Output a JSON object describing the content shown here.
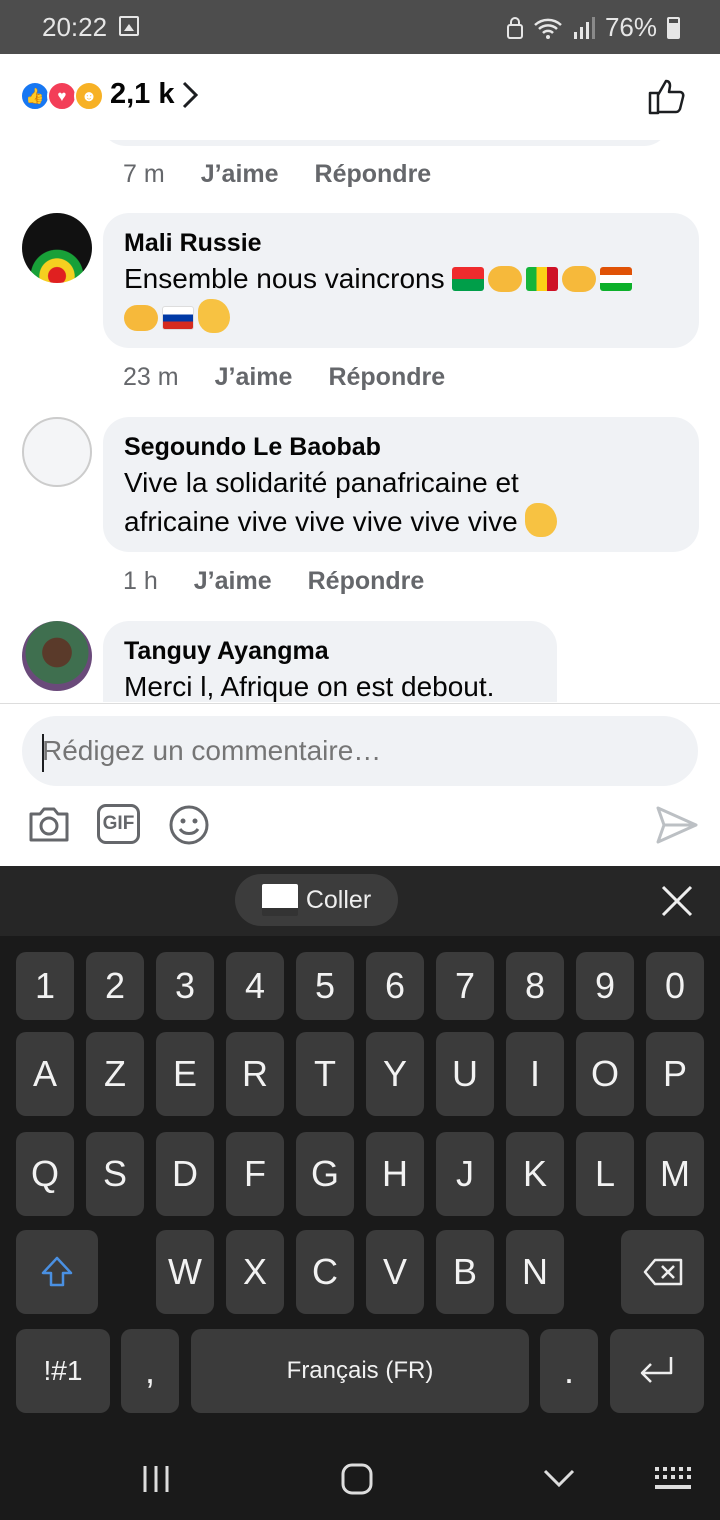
{
  "status_bar": {
    "time": "20:22",
    "battery": "76%"
  },
  "reactions": {
    "count": "2,1 k"
  },
  "comments": [
    {
      "meta": {
        "time": "7 m",
        "like": "J’aime",
        "reply": "Répondre"
      }
    },
    {
      "author": "Mali Russie",
      "text": "Ensemble nous vaincrons",
      "meta": {
        "time": "23 m",
        "like": "J’aime",
        "reply": "Répondre"
      }
    },
    {
      "author": "Segoundo Le Baobab",
      "text_line1": "Vive la solidarité panafricaine et",
      "text_line2": "africaine vive vive vive vive vive",
      "meta": {
        "time": "1 h",
        "like": "J’aime",
        "reply": "Répondre"
      }
    },
    {
      "author": "Tanguy Ayangma",
      "text": "Merci l, Afrique on est debout."
    }
  ],
  "composer": {
    "placeholder": "Rédigez un commentaire…",
    "gif_label": "GIF"
  },
  "keyboard": {
    "paste_label": "Coller",
    "row_numbers": [
      "1",
      "2",
      "3",
      "4",
      "5",
      "6",
      "7",
      "8",
      "9",
      "0"
    ],
    "row1": [
      "A",
      "Z",
      "E",
      "R",
      "T",
      "Y",
      "U",
      "I",
      "O",
      "P"
    ],
    "row2": [
      "Q",
      "S",
      "D",
      "F",
      "G",
      "H",
      "J",
      "K",
      "L",
      "M"
    ],
    "row3": [
      "W",
      "X",
      "C",
      "V",
      "B",
      "N"
    ],
    "symbols_label": "!#1",
    "comma_label": ",",
    "space_label": "Français (FR)",
    "period_label": "."
  }
}
